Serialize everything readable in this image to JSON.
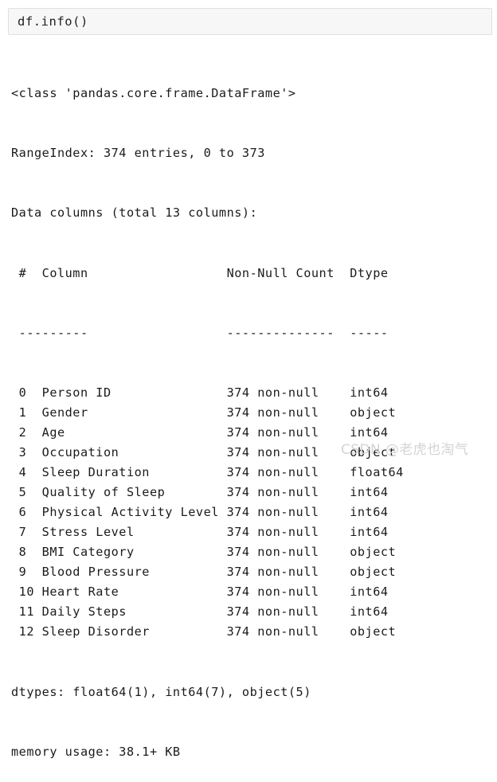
{
  "cell": {
    "code": "df.info()"
  },
  "output": {
    "header_lines": [
      "<class 'pandas.core.frame.DataFrame'>",
      "RangeIndex: 374 entries, 0 to 373",
      "Data columns (total 13 columns):"
    ],
    "table_header": {
      "index": "#",
      "column": "Column",
      "non_null_count": "Non-Null Count",
      "dtype": "Dtype"
    },
    "table_rule": {
      "index": "---",
      "column": "------",
      "non_null_count": "--------------",
      "dtype": "-----"
    },
    "rows": [
      {
        "index": "0",
        "column": "Person ID",
        "non_null_count": "374 non-null",
        "dtype": "int64"
      },
      {
        "index": "1",
        "column": "Gender",
        "non_null_count": "374 non-null",
        "dtype": "object"
      },
      {
        "index": "2",
        "column": "Age",
        "non_null_count": "374 non-null",
        "dtype": "int64"
      },
      {
        "index": "3",
        "column": "Occupation",
        "non_null_count": "374 non-null",
        "dtype": "object"
      },
      {
        "index": "4",
        "column": "Sleep Duration",
        "non_null_count": "374 non-null",
        "dtype": "float64"
      },
      {
        "index": "5",
        "column": "Quality of Sleep",
        "non_null_count": "374 non-null",
        "dtype": "int64"
      },
      {
        "index": "6",
        "column": "Physical Activity Level",
        "non_null_count": "374 non-null",
        "dtype": "int64"
      },
      {
        "index": "7",
        "column": "Stress Level",
        "non_null_count": "374 non-null",
        "dtype": "int64"
      },
      {
        "index": "8",
        "column": "BMI Category",
        "non_null_count": "374 non-null",
        "dtype": "object"
      },
      {
        "index": "9",
        "column": "Blood Pressure",
        "non_null_count": "374 non-null",
        "dtype": "object"
      },
      {
        "index": "10",
        "column": "Heart Rate",
        "non_null_count": "374 non-null",
        "dtype": "int64"
      },
      {
        "index": "11",
        "column": "Daily Steps",
        "non_null_count": "374 non-null",
        "dtype": "int64"
      },
      {
        "index": "12",
        "column": "Sleep Disorder",
        "non_null_count": "374 non-null",
        "dtype": "object"
      }
    ],
    "footer_lines": [
      "dtypes: float64(1), int64(7), object(5)",
      "memory usage: 38.1+ KB"
    ]
  },
  "watermark": {
    "text": "CSDN @老虎也淘气"
  },
  "colors": {
    "cell_background": "#f7f7f7",
    "cell_border": "#e0e0e0",
    "text": "#1b1b1b",
    "watermark": "#d4d4d4",
    "page_background": "#ffffff"
  }
}
